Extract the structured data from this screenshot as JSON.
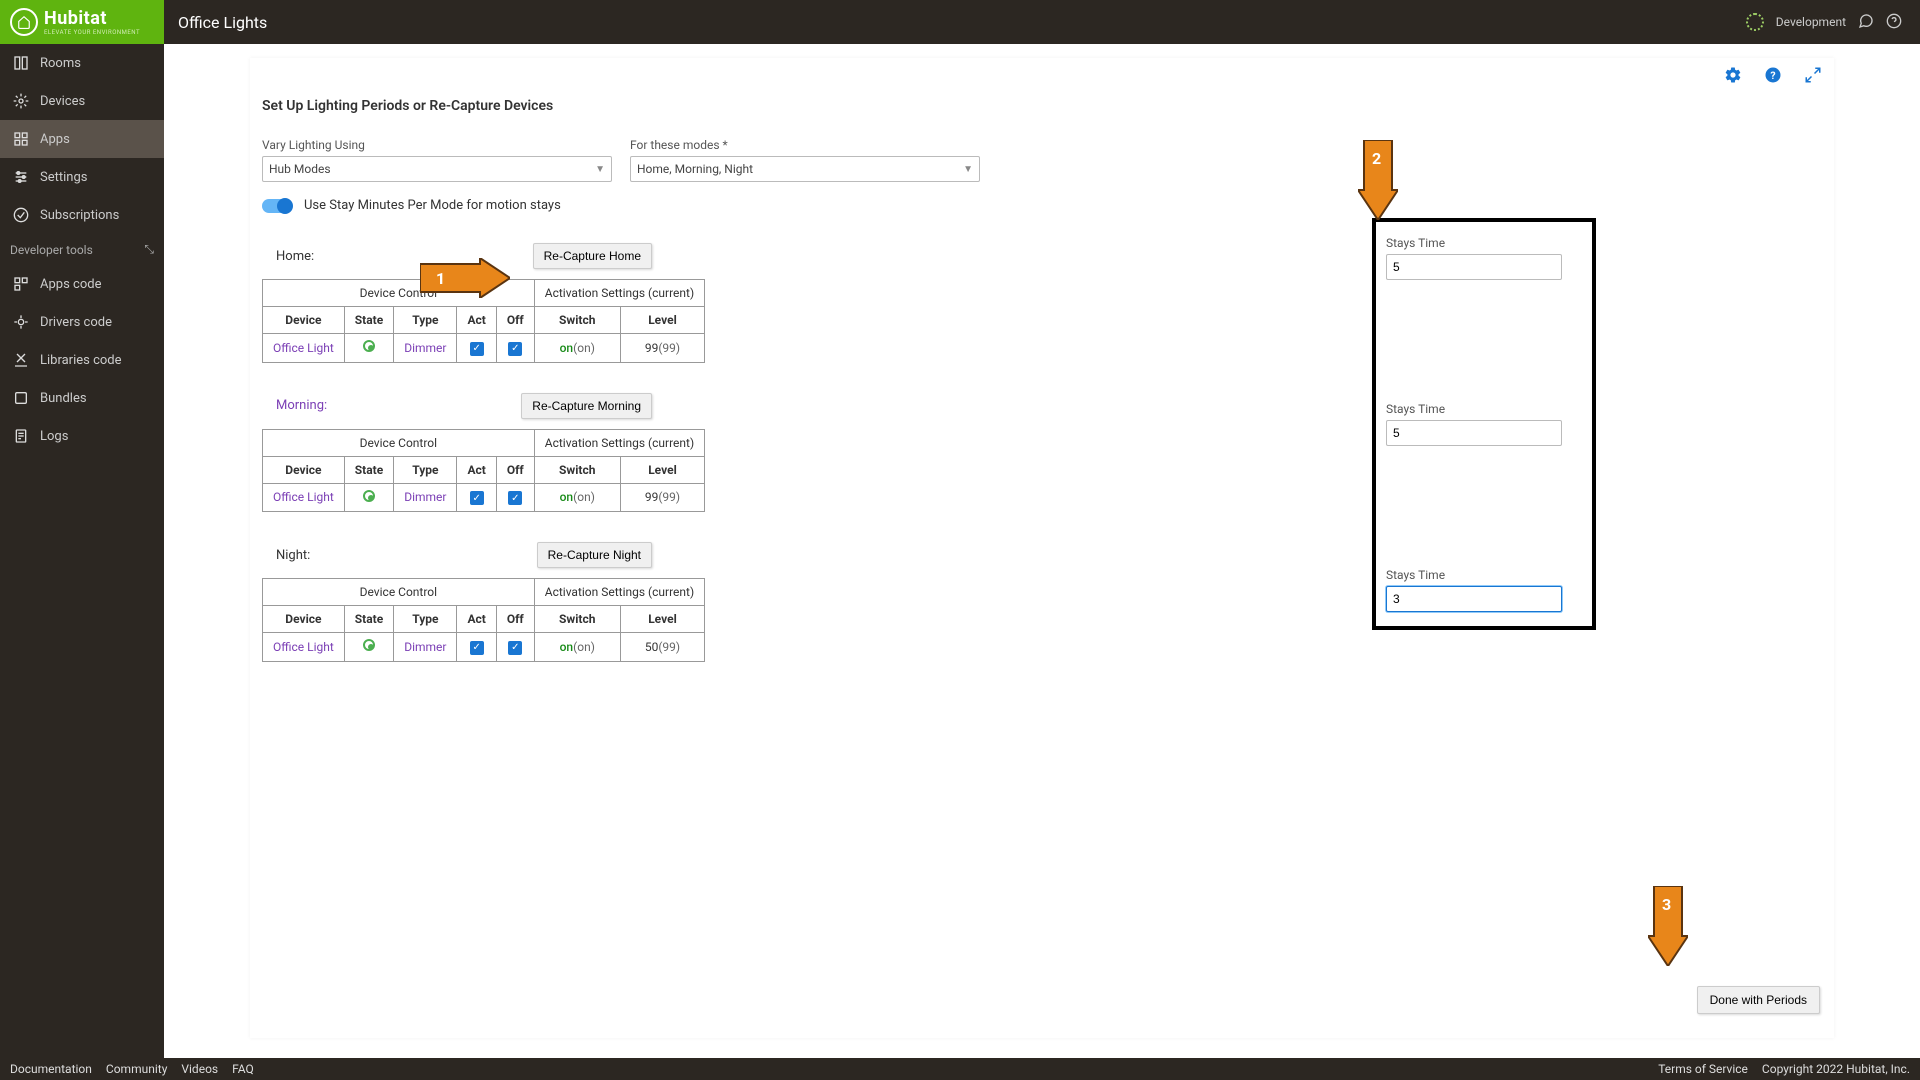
{
  "brand": {
    "name": "Hubitat",
    "tagline": "ELEVATE YOUR ENVIRONMENT"
  },
  "header": {
    "title": "Office Lights",
    "env_label": "Development"
  },
  "sidebar": {
    "items": [
      {
        "label": "Rooms"
      },
      {
        "label": "Devices"
      },
      {
        "label": "Apps"
      },
      {
        "label": "Settings"
      },
      {
        "label": "Subscriptions"
      }
    ],
    "dev_group": "Developer tools",
    "dev_items": [
      {
        "label": "Apps code"
      },
      {
        "label": "Drivers code"
      },
      {
        "label": "Libraries code"
      },
      {
        "label": "Bundles"
      },
      {
        "label": "Logs"
      }
    ]
  },
  "section_title": "Set Up Lighting Periods or Re-Capture Devices",
  "vary": {
    "label": "Vary Lighting Using",
    "value": "Hub Modes"
  },
  "modes": {
    "label": "For these modes *",
    "value": "Home, Morning, Night"
  },
  "toggle_label": "Use Stay Minutes Per Mode for motion stays",
  "columns": {
    "device_control": "Device Control",
    "activation": "Activation Settings (current)",
    "device": "Device",
    "state": "State",
    "type": "Type",
    "act": "Act",
    "off": "Off",
    "switch": "Switch",
    "level": "Level"
  },
  "periods": [
    {
      "name": "Home",
      "class": "home",
      "recapture": "Re-Capture Home",
      "row": {
        "device": "Office Light",
        "type": "Dimmer",
        "switch_on": "on",
        "switch_cur": "(on)",
        "level": "99",
        "level_cur": "(99)"
      }
    },
    {
      "name": "Morning",
      "class": "morning",
      "recapture": "Re-Capture Morning",
      "row": {
        "device": "Office Light",
        "type": "Dimmer",
        "switch_on": "on",
        "switch_cur": "(on)",
        "level": "99",
        "level_cur": "(99)"
      }
    },
    {
      "name": "Night",
      "class": "night",
      "recapture": "Re-Capture Night",
      "row": {
        "device": "Office Light",
        "type": "Dimmer",
        "switch_on": "on",
        "switch_cur": "(on)",
        "level": "50",
        "level_cur": "(99)"
      }
    }
  ],
  "stays": [
    {
      "label": "Stays Time",
      "value": "5"
    },
    {
      "label": "Stays Time",
      "value": "5"
    },
    {
      "label": "Stays Time",
      "value": "3"
    }
  ],
  "done_label": "Done with Periods",
  "footer": {
    "links": [
      "Documentation",
      "Community",
      "Videos",
      "FAQ"
    ],
    "right": [
      "Terms of Service",
      "Copyright 2022 Hubitat, Inc."
    ]
  },
  "colors": {
    "accent": "#1976d2",
    "brand": "#5fb40f",
    "dark": "#2c2722"
  }
}
